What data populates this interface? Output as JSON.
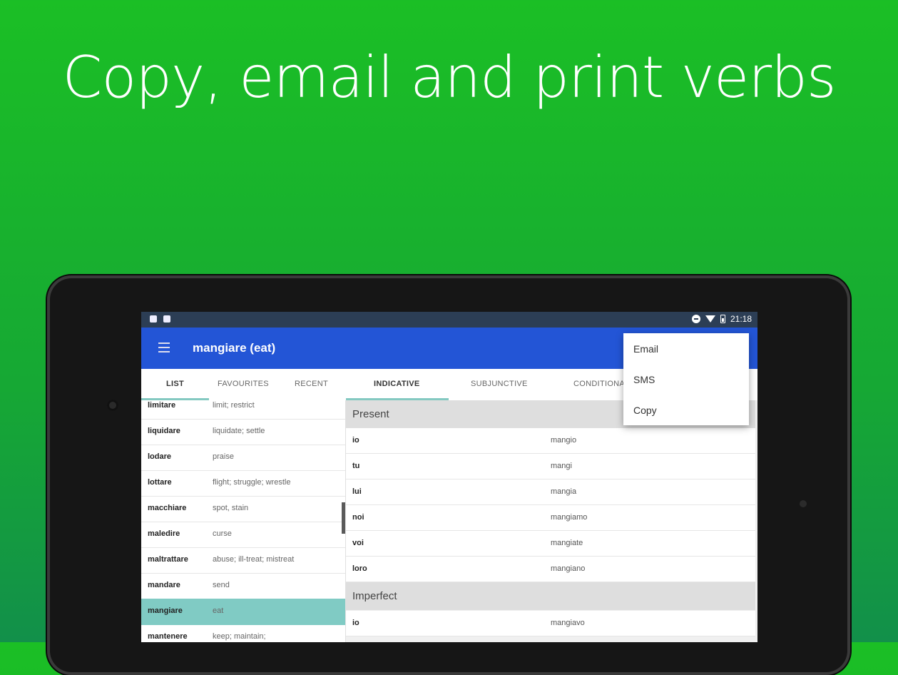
{
  "headline": "Copy, email and print verbs",
  "status": {
    "time": "21:18"
  },
  "appbar": {
    "title": "mangiare (eat)"
  },
  "tabs": [
    {
      "label": "LIST"
    },
    {
      "label": "FAVOURITES"
    },
    {
      "label": "RECENT"
    },
    {
      "label": "INDICATIVE"
    },
    {
      "label": "SUBJUNCTIVE"
    },
    {
      "label": "CONDITIONAL"
    }
  ],
  "verbs": [
    {
      "verb": "limitare",
      "meaning": "limit; restrict"
    },
    {
      "verb": "liquidare",
      "meaning": "liquidate; settle"
    },
    {
      "verb": "lodare",
      "meaning": "praise"
    },
    {
      "verb": "lottare",
      "meaning": "flight; struggle; wrestle"
    },
    {
      "verb": "macchiare",
      "meaning": "spot, stain"
    },
    {
      "verb": "maledire",
      "meaning": "curse"
    },
    {
      "verb": "maltrattare",
      "meaning": "abuse; ill-treat; mistreat"
    },
    {
      "verb": "mandare",
      "meaning": "send"
    },
    {
      "verb": "mangiare",
      "meaning": "eat"
    },
    {
      "verb": "mantenere",
      "meaning": "keep; maintain;"
    }
  ],
  "sections": {
    "present": {
      "title": "Present",
      "rows": [
        {
          "person": "io",
          "form": "mangio"
        },
        {
          "person": "tu",
          "form": "mangi"
        },
        {
          "person": "lui",
          "form": "mangia"
        },
        {
          "person": "noi",
          "form": "mangiamo"
        },
        {
          "person": "voi",
          "form": "mangiate"
        },
        {
          "person": "loro",
          "form": "mangiano"
        }
      ]
    },
    "imperfect": {
      "title": "Imperfect",
      "rows": [
        {
          "person": "io",
          "form": "mangiavo"
        }
      ]
    }
  },
  "share_menu": [
    "Email",
    "SMS",
    "Copy"
  ]
}
